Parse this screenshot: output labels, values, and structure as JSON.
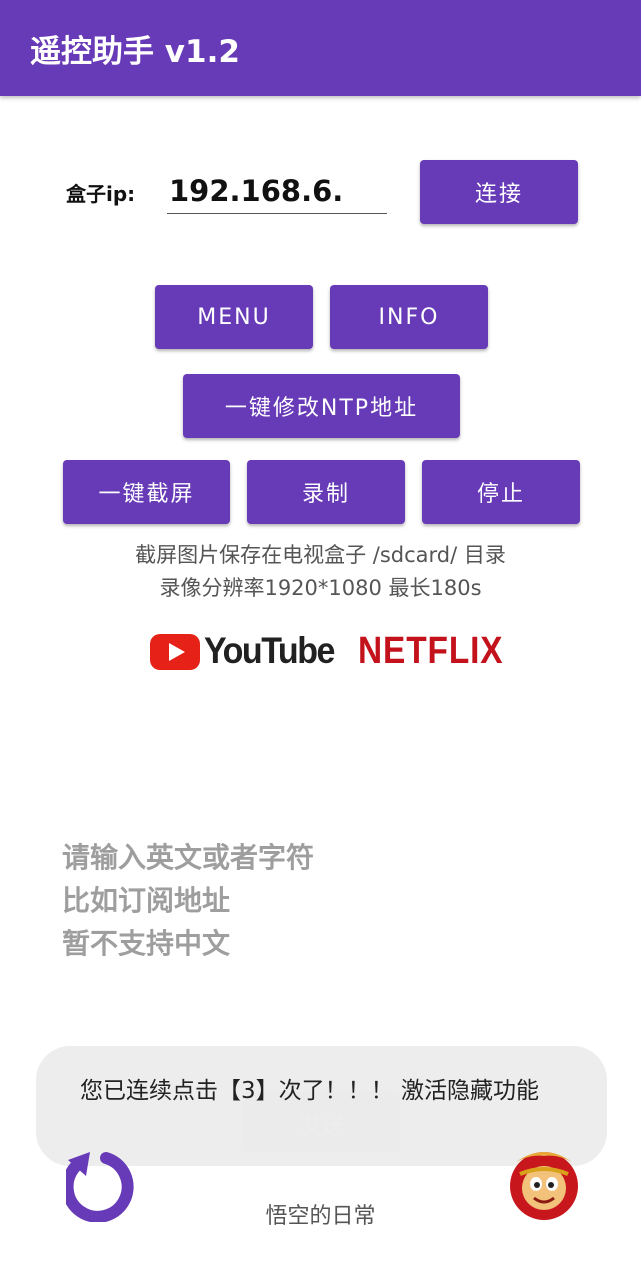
{
  "appbar": {
    "title": "遥控助手 v1.2",
    "color": "#673ab7"
  },
  "connection": {
    "ip_label": "盒子ip:",
    "ip_value": "192.168.6.",
    "connect_label": "连接"
  },
  "buttons": {
    "menu": "MENU",
    "info": "INFO",
    "ntp": "一键修改NTP地址",
    "screenshot": "一键截屏",
    "record": "录制",
    "stop": "停止"
  },
  "notes": {
    "line1": "截屏图片保存在电视盒子 /sdcard/ 目录",
    "line2": "录像分辨率1920*1080 最长180s"
  },
  "logos": {
    "youtube": "YouTube",
    "netflix": "NETFLIX"
  },
  "input_hint": {
    "line1": "请输入英文或者字符",
    "line2": "比如订阅地址",
    "line3": "暂不支持中文"
  },
  "send_label": "发送",
  "toast": "您已连续点击【3】次了！！！ 激活隐藏功能",
  "footer": "悟空的日常",
  "icons": {
    "back": "undo-arrow-icon",
    "avatar": "monkey-king-icon"
  }
}
